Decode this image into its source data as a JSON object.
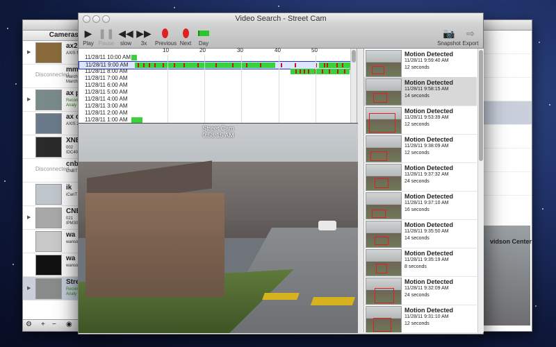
{
  "window": {
    "title": "Video Search - Street Cam"
  },
  "toolbar": {
    "play": "Play",
    "pause": "Pause",
    "slow": "slow",
    "fast": "3x",
    "previous": "Previous",
    "next": "Next",
    "day": "Day",
    "snapshot": "Snapshot",
    "export": "Export"
  },
  "cameras": {
    "header": "Cameras",
    "items": [
      {
        "name": "ax2",
        "sub1": "AXIS M",
        "sub2": ""
      },
      {
        "name": "mm",
        "sub1": "March",
        "sub2": "March",
        "offline": "Disconnected"
      },
      {
        "name": "ax p",
        "sub1": "Recon",
        "sub2": "Analy"
      },
      {
        "name": "ax c",
        "sub1": "AXIS 2",
        "sub2": ""
      },
      {
        "name": "XNE",
        "sub1": "002",
        "sub2": "IDC40"
      },
      {
        "name": "cnb",
        "sub1": "CNBT",
        "sub2": "",
        "offline": "Disconnected"
      },
      {
        "name": "ik",
        "sub1": "iCanT",
        "sub2": ""
      },
      {
        "name": "CNB",
        "sub1": "021",
        "sub2": "IPM30"
      },
      {
        "name": "wa",
        "sub1": "wanso",
        "sub2": ""
      },
      {
        "name": "wa",
        "sub1": "wanso",
        "sub2": ""
      },
      {
        "name": "Stre",
        "sub1": "Recon",
        "sub2": "Analy"
      }
    ],
    "footer": {
      "gear": "⚙",
      "add": "+",
      "remove": "−",
      "eye": "◉"
    }
  },
  "timeline": {
    "ticks": [
      "10",
      "20",
      "30",
      "40",
      "50"
    ],
    "rows": [
      "11/28/11 10:00 AM",
      "11/28/11 9:00 AM",
      "11/28/11 8:00 AM",
      "11/28/11 7:00 AM",
      "11/28/11 6:00 AM",
      "11/28/11 5:00 AM",
      "11/28/11 4:00 AM",
      "11/28/11 3:00 AM",
      "11/28/11 2:00 AM",
      "11/28/11 1:00 AM"
    ]
  },
  "video": {
    "camera": "Street Cam",
    "time": "9:58:15 AM"
  },
  "motion": {
    "items": [
      {
        "title": "Motion Detected",
        "date": "11/28/11 9:59:40 AM",
        "duration": "12 seconds"
      },
      {
        "title": "Motion Detected",
        "date": "11/28/11 9:58:15 AM",
        "duration": "14 seconds"
      },
      {
        "title": "Motion Detected",
        "date": "11/28/11 9:53:39 AM",
        "duration": "12 seconds"
      },
      {
        "title": "Motion Detected",
        "date": "11/28/11 9:38:09 AM",
        "duration": "12 seconds"
      },
      {
        "title": "Motion Detected",
        "date": "11/28/11 9:37:32 AM",
        "duration": "24 seconds"
      },
      {
        "title": "Motion Detected",
        "date": "11/28/11 9:37:10 AM",
        "duration": "16 seconds"
      },
      {
        "title": "Motion Detected",
        "date": "11/28/11 9:35:50 AM",
        "duration": "14 seconds"
      },
      {
        "title": "Motion Detected",
        "date": "11/28/11 9:35:19 AM",
        "duration": "8 seconds"
      },
      {
        "title": "Motion Detected",
        "date": "11/28/11 9:32:09 AM",
        "duration": "24 seconds"
      },
      {
        "title": "Motion Detected",
        "date": "11/28/11 9:31:10 AM",
        "duration": "12 seconds"
      }
    ]
  },
  "background_window": {
    "sign": "vidson Center"
  }
}
